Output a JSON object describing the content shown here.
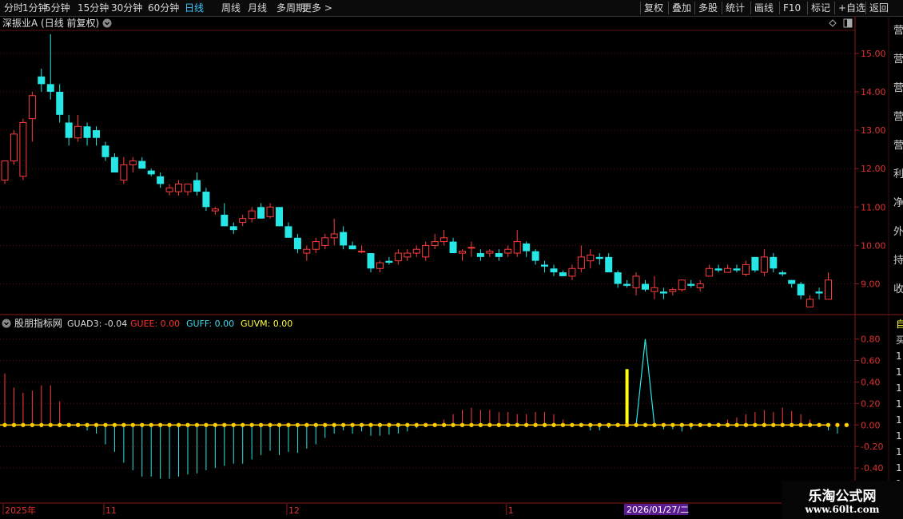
{
  "toolbar": {
    "left_items": [
      {
        "label": "分时"
      },
      {
        "label": "1分钟"
      },
      {
        "label": "5分钟"
      },
      {
        "label": "15分钟"
      },
      {
        "label": "30分钟"
      },
      {
        "label": "60分钟"
      },
      {
        "label": "日线",
        "active": true
      },
      {
        "label": "周线"
      },
      {
        "label": "月线"
      },
      {
        "label": "多周期"
      },
      {
        "label": "更多 >"
      }
    ],
    "right_items": [
      {
        "label": "复权"
      },
      {
        "label": "叠加"
      },
      {
        "label": "多股"
      },
      {
        "label": "统计"
      },
      {
        "label": "画线"
      },
      {
        "label": "F10"
      },
      {
        "label": "标记"
      },
      {
        "label": "+自选"
      },
      {
        "label": "返回"
      }
    ]
  },
  "price_panel": {
    "title": "深振业A (日线 前复权)"
  },
  "indicator_panel": {
    "name": "股朋指标网",
    "values": [
      {
        "text": "GUAD3: -0.04",
        "color": "#dcdcdc"
      },
      {
        "text": "GUEE: 0.00",
        "color": "#ff3030"
      },
      {
        "text": "GUFF: 0.00",
        "color": "#3cdcf0"
      },
      {
        "text": "GUVM: 0.00",
        "color": "#ffff3c"
      }
    ]
  },
  "time_axis": {
    "labels": [
      {
        "text": "2025年",
        "i": 0
      },
      {
        "text": "11",
        "i": 11
      },
      {
        "text": "12",
        "i": 31
      },
      {
        "text": "1",
        "i": 55
      }
    ],
    "cursor_label": {
      "text": "2026/01/27/二",
      "i": 68
    }
  },
  "right_sidebar": {
    "labels": [
      "营",
      "营",
      "营",
      "营",
      "营",
      "利",
      "净",
      "外",
      "持",
      "收"
    ],
    "ind_labels": [
      "自",
      "买",
      "1",
      "1",
      "1",
      "1",
      "1",
      "1",
      "1",
      "1",
      "1"
    ]
  },
  "watermark": {
    "title": "乐淘公式网",
    "url": "www.60lt.com"
  },
  "colors": {
    "up": "#ff3c3c",
    "down": "#26e6e6",
    "panel_border": "#8b1a1a",
    "signal": "#ffff00",
    "dot": "#ffcc00"
  },
  "chart_data": {
    "type": "candlestick",
    "ylim": [
      8.2,
      15.6
    ],
    "y_ticks": [
      9.0,
      10.0,
      11.0,
      12.0,
      13.0,
      14.0,
      15.0
    ],
    "ohlc": [
      [
        11.7,
        12.2,
        11.6,
        12.2
      ],
      [
        12.2,
        13.0,
        12.1,
        12.9
      ],
      [
        11.8,
        13.3,
        11.7,
        13.2
      ],
      [
        13.3,
        14.0,
        12.7,
        13.9
      ],
      [
        14.4,
        14.6,
        14.0,
        14.2
      ],
      [
        14.2,
        15.5,
        13.8,
        14.0
      ],
      [
        14.0,
        14.2,
        13.2,
        13.4
      ],
      [
        13.2,
        13.4,
        12.6,
        12.8
      ],
      [
        12.8,
        13.4,
        12.7,
        13.1
      ],
      [
        13.1,
        13.2,
        12.6,
        12.8
      ],
      [
        13.0,
        13.1,
        12.6,
        12.8
      ],
      [
        12.6,
        12.7,
        12.2,
        12.3
      ],
      [
        12.3,
        12.4,
        11.9,
        11.9
      ],
      [
        11.7,
        12.3,
        11.6,
        12.1
      ],
      [
        12.1,
        12.3,
        11.9,
        12.2
      ],
      [
        12.2,
        12.3,
        12.0,
        12.0
      ],
      [
        11.95,
        12.0,
        11.8,
        11.85
      ],
      [
        11.8,
        11.9,
        11.5,
        11.6
      ],
      [
        11.4,
        11.6,
        11.3,
        11.5
      ],
      [
        11.4,
        11.7,
        11.3,
        11.6
      ],
      [
        11.4,
        11.6,
        11.3,
        11.6
      ],
      [
        11.7,
        11.9,
        11.3,
        11.4
      ],
      [
        11.4,
        11.5,
        10.9,
        11.0
      ],
      [
        10.9,
        11.0,
        10.8,
        10.95
      ],
      [
        10.8,
        11.1,
        10.5,
        10.5
      ],
      [
        10.5,
        10.6,
        10.3,
        10.4
      ],
      [
        10.6,
        10.8,
        10.5,
        10.7
      ],
      [
        10.7,
        11.0,
        10.6,
        10.9
      ],
      [
        11.0,
        11.1,
        10.7,
        10.7
      ],
      [
        10.75,
        11.1,
        10.7,
        11.0
      ],
      [
        11.0,
        11.0,
        10.5,
        10.5
      ],
      [
        10.5,
        10.6,
        10.2,
        10.2
      ],
      [
        10.2,
        10.3,
        9.8,
        9.9
      ],
      [
        9.8,
        10.0,
        9.6,
        9.9
      ],
      [
        9.9,
        10.2,
        9.8,
        10.1
      ],
      [
        10.0,
        10.3,
        9.9,
        10.2
      ],
      [
        10.2,
        10.7,
        10.0,
        10.3
      ],
      [
        10.35,
        10.5,
        9.9,
        10.0
      ],
      [
        10.0,
        10.1,
        9.9,
        9.9
      ],
      [
        9.85,
        10.0,
        9.8,
        9.85
      ],
      [
        9.8,
        9.8,
        9.3,
        9.4
      ],
      [
        9.4,
        9.6,
        9.3,
        9.55
      ],
      [
        9.6,
        9.7,
        9.5,
        9.55
      ],
      [
        9.6,
        9.9,
        9.5,
        9.8
      ],
      [
        9.7,
        9.9,
        9.6,
        9.8
      ],
      [
        9.8,
        10.0,
        9.7,
        9.9
      ],
      [
        9.7,
        10.1,
        9.6,
        10.0
      ],
      [
        10.0,
        10.3,
        9.9,
        10.1
      ],
      [
        10.1,
        10.4,
        10.0,
        10.2
      ],
      [
        10.1,
        10.2,
        9.8,
        9.8
      ],
      [
        9.8,
        9.9,
        9.6,
        9.85
      ],
      [
        9.95,
        10.1,
        9.7,
        9.95
      ],
      [
        9.8,
        9.9,
        9.6,
        9.7
      ],
      [
        9.8,
        9.9,
        9.7,
        9.85
      ],
      [
        9.8,
        9.9,
        9.6,
        9.7
      ],
      [
        9.8,
        10.0,
        9.7,
        9.9
      ],
      [
        9.8,
        10.4,
        9.7,
        10.1
      ],
      [
        10.05,
        10.1,
        9.7,
        9.85
      ],
      [
        9.85,
        9.9,
        9.5,
        9.6
      ],
      [
        9.5,
        9.6,
        9.3,
        9.45
      ],
      [
        9.4,
        9.5,
        9.2,
        9.3
      ],
      [
        9.3,
        9.35,
        9.2,
        9.2
      ],
      [
        9.2,
        9.5,
        9.1,
        9.4
      ],
      [
        9.4,
        10.0,
        9.3,
        9.7
      ],
      [
        9.6,
        9.9,
        9.4,
        9.75
      ],
      [
        9.7,
        9.8,
        9.5,
        9.65
      ],
      [
        9.7,
        9.8,
        9.3,
        9.3
      ],
      [
        9.3,
        9.35,
        8.9,
        9.0
      ],
      [
        9.0,
        9.1,
        8.9,
        8.95
      ],
      [
        8.9,
        9.3,
        8.7,
        9.2
      ],
      [
        9.0,
        9.1,
        8.8,
        8.85
      ],
      [
        8.8,
        9.2,
        8.6,
        8.9
      ],
      [
        8.8,
        8.9,
        8.6,
        8.75
      ],
      [
        8.8,
        8.9,
        8.7,
        8.85
      ],
      [
        8.85,
        9.1,
        8.8,
        9.1
      ],
      [
        9.0,
        9.1,
        8.9,
        8.95
      ],
      [
        8.9,
        9.1,
        8.8,
        9.0
      ],
      [
        9.2,
        9.5,
        9.2,
        9.4
      ],
      [
        9.4,
        9.5,
        9.3,
        9.35
      ],
      [
        9.3,
        9.5,
        9.3,
        9.4
      ],
      [
        9.4,
        9.5,
        9.3,
        9.35
      ],
      [
        9.25,
        9.6,
        9.2,
        9.5
      ],
      [
        9.7,
        9.7,
        9.3,
        9.35
      ],
      [
        9.3,
        9.9,
        9.2,
        9.7
      ],
      [
        9.7,
        9.8,
        9.3,
        9.4
      ],
      [
        9.3,
        9.35,
        9.2,
        9.25
      ],
      [
        9.1,
        9.1,
        8.9,
        9.0
      ],
      [
        9.0,
        9.05,
        8.6,
        8.7
      ],
      [
        8.4,
        8.7,
        8.4,
        8.6
      ],
      [
        8.8,
        8.9,
        8.6,
        8.75
      ],
      [
        8.6,
        9.3,
        8.6,
        9.1
      ]
    ],
    "indicator": {
      "ylim": [
        -0.44,
        0.86
      ],
      "y_ticks": [
        0.8,
        0.6,
        0.4,
        0.2,
        -0.0,
        -0.2,
        -0.4
      ],
      "guad3": [
        0.48,
        0.35,
        0.3,
        0.32,
        0.37,
        0.37,
        0.22,
        0,
        -0.02,
        -0.05,
        -0.08,
        -0.18,
        -0.25,
        -0.35,
        -0.42,
        -0.48,
        -0.48,
        -0.5,
        -0.5,
        -0.48,
        -0.46,
        -0.45,
        -0.42,
        -0.4,
        -0.38,
        -0.36,
        -0.36,
        -0.32,
        -0.28,
        -0.24,
        -0.28,
        -0.25,
        -0.26,
        -0.22,
        -0.18,
        -0.12,
        -0.08,
        -0.05,
        -0.08,
        -0.06,
        -0.1,
        -0.1,
        -0.09,
        -0.08,
        -0.06,
        -0.03,
        0,
        0.02,
        0.05,
        0.1,
        0.14,
        0.16,
        0.14,
        0.14,
        0.12,
        0.12,
        0.1,
        0.1,
        0.12,
        0.12,
        0.1,
        0.05,
        0,
        0,
        -0.05,
        -0.05,
        -0.03,
        0,
        0,
        0,
        -0.02,
        -0.02,
        -0.04,
        -0.04,
        -0.06,
        -0.04,
        0,
        0,
        0.02,
        0.05,
        0.07,
        0.1,
        0.12,
        0.14,
        0.12,
        0.16,
        0.13,
        0.1,
        0.05,
        0,
        -0.05,
        -0.08
      ],
      "signal_bar": {
        "i": 68,
        "value": 0.52
      },
      "spike": {
        "start": 69,
        "peak": 70,
        "end": 71,
        "value": 0.8
      },
      "dot_count": 93
    }
  }
}
